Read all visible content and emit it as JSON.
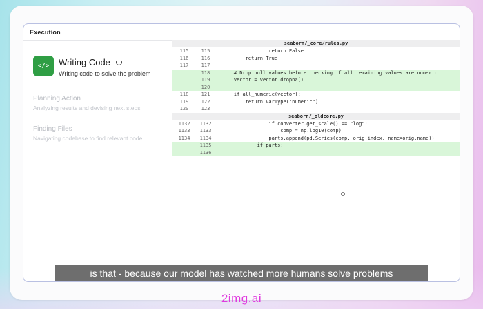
{
  "panel": {
    "title": "Execution"
  },
  "steps": {
    "active": {
      "icon_glyph": "</>",
      "icon": "code-icon",
      "title": "Writing Code",
      "description": "Writing code to solve the problem"
    },
    "pending": [
      {
        "title": "Planning Action",
        "description": "Analyzing results and devising next steps"
      },
      {
        "title": "Finding Files",
        "description": "Navigating codebase to find relevant code"
      }
    ]
  },
  "diff": {
    "files": [
      {
        "name": "seaborn/_core/rules.py",
        "lines": [
          {
            "old": "115",
            "new": "115",
            "code": "                return False",
            "added": false
          },
          {
            "old": "116",
            "new": "116",
            "code": "        return True",
            "added": false
          },
          {
            "old": "117",
            "new": "117",
            "code": "",
            "added": false
          },
          {
            "old": "",
            "new": "118",
            "code": "    # Drop null values before checking if all remaining values are numeric",
            "added": true
          },
          {
            "old": "",
            "new": "119",
            "code": "    vector = vector.dropna()",
            "added": true
          },
          {
            "old": "",
            "new": "120",
            "code": "",
            "added": true
          },
          {
            "old": "118",
            "new": "121",
            "code": "    if all_numeric(vector):",
            "added": false
          },
          {
            "old": "119",
            "new": "122",
            "code": "        return VarType(\"numeric\")",
            "added": false
          },
          {
            "old": "120",
            "new": "123",
            "code": "",
            "added": false
          }
        ]
      },
      {
        "name": "seaborn/_oldcore.py",
        "lines": [
          {
            "old": "1132",
            "new": "1132",
            "code": "                if converter.get_scale() == \"log\":",
            "added": false
          },
          {
            "old": "1133",
            "new": "1133",
            "code": "                    comp = np.log10(comp)",
            "added": false
          },
          {
            "old": "1134",
            "new": "1134",
            "code": "                parts.append(pd.Series(comp, orig.index, name=orig.name))",
            "added": false
          },
          {
            "old": "",
            "new": "1135",
            "code": "            if parts:",
            "added": true
          },
          {
            "old": "",
            "new": "1136",
            "code": "",
            "added": true
          }
        ]
      }
    ]
  },
  "caption": "is that - because our model has watched more humans solve problems",
  "watermark": "2img.ai",
  "colors": {
    "accent_green": "#2f9e44",
    "added_line_bg": "#d9f6d9",
    "panel_border": "#b9c0e2",
    "watermark": "#e03adf"
  }
}
